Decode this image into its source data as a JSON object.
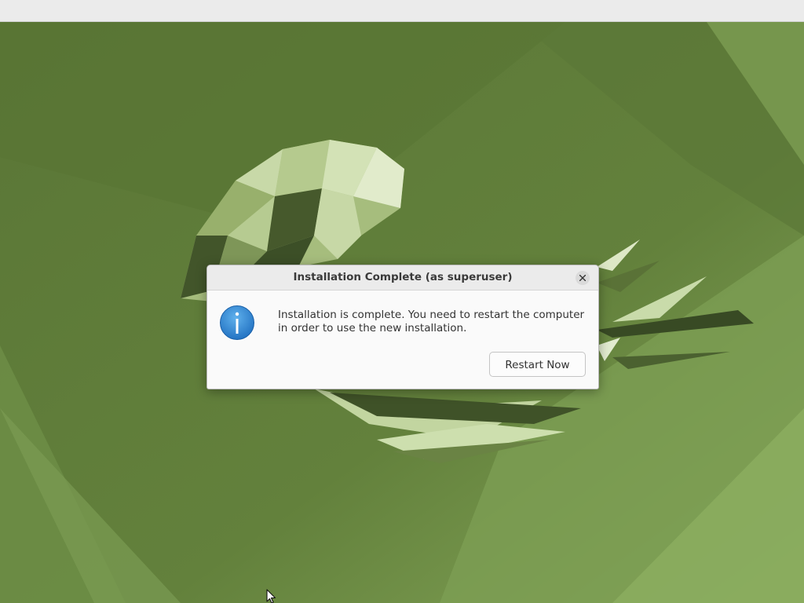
{
  "dialog": {
    "title": "Installation Complete (as superuser)",
    "message": "Installation is complete. You need to restart the computer in order to use the new installation.",
    "restart_label": "Restart Now",
    "close_icon": "close-icon",
    "info_icon": "info-icon"
  },
  "desktop": {
    "wallpaper": "green-polygon-jellyfish",
    "accent_color": "#5f7d3a"
  },
  "pointer": {
    "icon": "mouse-pointer-icon"
  }
}
